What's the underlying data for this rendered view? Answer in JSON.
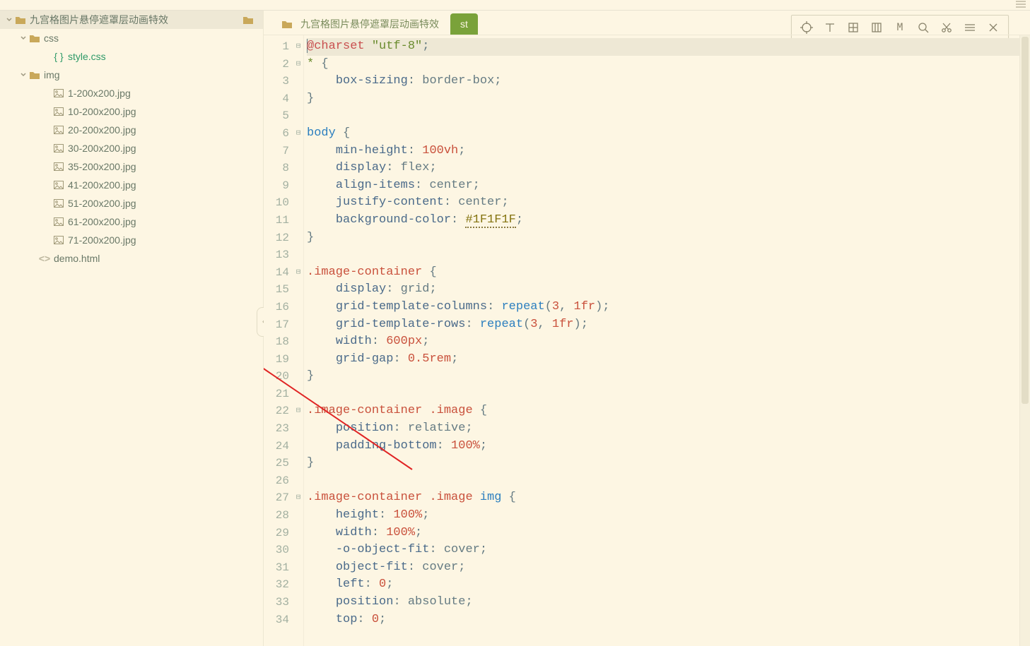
{
  "sidebar": {
    "root": {
      "name": "九宫格图片悬停遮罩层动画特效"
    },
    "css_folder": "css",
    "css_file": "style.css",
    "img_folder": "img",
    "img_files": [
      "1-200x200.jpg",
      "10-200x200.jpg",
      "20-200x200.jpg",
      "30-200x200.jpg",
      "35-200x200.jpg",
      "41-200x200.jpg",
      "51-200x200.jpg",
      "61-200x200.jpg",
      "71-200x200.jpg"
    ],
    "demo_file": "demo.html"
  },
  "tabs": {
    "inactive": "九宫格图片悬停遮罩层动画特效",
    "active_prefix": "st"
  },
  "code": {
    "lines": [
      {
        "n": 1,
        "fold": "⊟",
        "html": "<span class='cursor'></span><span class='tk-at'>@charset</span> <span class='tk-str'>\"utf-8\"</span><span class='tk-punc'>;</span>",
        "active": true
      },
      {
        "n": 2,
        "fold": "⊟",
        "html": "<span class='tk-sel'>*</span> <span class='tk-punc'>{</span>"
      },
      {
        "n": 3,
        "fold": "",
        "html": "    <span class='tk-prop'>box-sizing</span><span class='tk-punc'>:</span> <span class='tk-val'>border-box</span><span class='tk-punc'>;</span>"
      },
      {
        "n": 4,
        "fold": "",
        "html": "<span class='tk-punc'>}</span>"
      },
      {
        "n": 5,
        "fold": "",
        "html": " "
      },
      {
        "n": 6,
        "fold": "⊟",
        "html": "<span class='tk-tag'>body</span> <span class='tk-punc'>{</span>"
      },
      {
        "n": 7,
        "fold": "",
        "html": "    <span class='tk-prop'>min-height</span><span class='tk-punc'>:</span> <span class='tk-num'>100</span><span class='tk-unit'>vh</span><span class='tk-punc'>;</span>"
      },
      {
        "n": 8,
        "fold": "",
        "html": "    <span class='tk-prop'>display</span><span class='tk-punc'>:</span> <span class='tk-val'>flex</span><span class='tk-punc'>;</span>"
      },
      {
        "n": 9,
        "fold": "",
        "html": "    <span class='tk-prop'>align-items</span><span class='tk-punc'>:</span> <span class='tk-val'>center</span><span class='tk-punc'>;</span>"
      },
      {
        "n": 10,
        "fold": "",
        "html": "    <span class='tk-prop'>justify-content</span><span class='tk-punc'>:</span> <span class='tk-val'>center</span><span class='tk-punc'>;</span>"
      },
      {
        "n": 11,
        "fold": "",
        "html": "    <span class='tk-prop'>background-color</span><span class='tk-punc'>:</span> <span class='tk-hex'>#1F1F1F</span><span class='tk-punc'>;</span>"
      },
      {
        "n": 12,
        "fold": "",
        "html": "<span class='tk-punc'>}</span>"
      },
      {
        "n": 13,
        "fold": "",
        "html": " "
      },
      {
        "n": 14,
        "fold": "⊟",
        "html": "<span class='tk-cls'>.image-container</span> <span class='tk-punc'>{</span>"
      },
      {
        "n": 15,
        "fold": "",
        "html": "    <span class='tk-prop'>display</span><span class='tk-punc'>:</span> <span class='tk-val'>grid</span><span class='tk-punc'>;</span>"
      },
      {
        "n": 16,
        "fold": "",
        "html": "    <span class='tk-prop'>grid-template-columns</span><span class='tk-punc'>:</span> <span class='tk-fn'>repeat</span><span class='tk-punc'>(</span><span class='tk-num'>3</span><span class='tk-punc'>,</span> <span class='tk-num'>1</span><span class='tk-unit'>fr</span><span class='tk-punc'>);</span>"
      },
      {
        "n": 17,
        "fold": "",
        "html": "    <span class='tk-prop'>grid-template-rows</span><span class='tk-punc'>:</span> <span class='tk-fn'>repeat</span><span class='tk-punc'>(</span><span class='tk-num'>3</span><span class='tk-punc'>,</span> <span class='tk-num'>1</span><span class='tk-unit'>fr</span><span class='tk-punc'>);</span>"
      },
      {
        "n": 18,
        "fold": "",
        "html": "    <span class='tk-prop'>width</span><span class='tk-punc'>:</span> <span class='tk-num'>600</span><span class='tk-unit'>px</span><span class='tk-punc'>;</span>"
      },
      {
        "n": 19,
        "fold": "",
        "html": "    <span class='tk-prop'>grid-gap</span><span class='tk-punc'>:</span> <span class='tk-num'>0.5</span><span class='tk-unit'>rem</span><span class='tk-punc'>;</span>"
      },
      {
        "n": 20,
        "fold": "",
        "html": "<span class='tk-punc'>}</span>"
      },
      {
        "n": 21,
        "fold": "",
        "html": " "
      },
      {
        "n": 22,
        "fold": "⊟",
        "html": "<span class='tk-cls'>.image-container</span> <span class='tk-cls'>.image</span> <span class='tk-punc'>{</span>"
      },
      {
        "n": 23,
        "fold": "",
        "html": "    <span class='tk-prop'>position</span><span class='tk-punc'>:</span> <span class='tk-val'>relative</span><span class='tk-punc'>;</span>"
      },
      {
        "n": 24,
        "fold": "",
        "html": "    <span class='tk-prop'>padding-bottom</span><span class='tk-punc'>:</span> <span class='tk-num'>100</span><span class='tk-pct'>%</span><span class='tk-punc'>;</span>"
      },
      {
        "n": 25,
        "fold": "",
        "html": "<span class='tk-punc'>}</span>"
      },
      {
        "n": 26,
        "fold": "",
        "html": " "
      },
      {
        "n": 27,
        "fold": "⊟",
        "html": "<span class='tk-cls'>.image-container</span> <span class='tk-cls'>.image</span> <span class='tk-tag'>img</span> <span class='tk-punc'>{</span>"
      },
      {
        "n": 28,
        "fold": "",
        "html": "    <span class='tk-prop'>height</span><span class='tk-punc'>:</span> <span class='tk-num'>100</span><span class='tk-pct'>%</span><span class='tk-punc'>;</span>"
      },
      {
        "n": 29,
        "fold": "",
        "html": "    <span class='tk-prop'>width</span><span class='tk-punc'>:</span> <span class='tk-num'>100</span><span class='tk-pct'>%</span><span class='tk-punc'>;</span>"
      },
      {
        "n": 30,
        "fold": "",
        "html": "    <span class='tk-prop'>-o-object-fit</span><span class='tk-punc'>:</span> <span class='tk-val'>cover</span><span class='tk-punc'>;</span>"
      },
      {
        "n": 31,
        "fold": "",
        "html": "    <span class='tk-prop'>object-fit</span><span class='tk-punc'>:</span> <span class='tk-val'>cover</span><span class='tk-punc'>;</span>"
      },
      {
        "n": 32,
        "fold": "",
        "html": "    <span class='tk-prop'>left</span><span class='tk-punc'>:</span> <span class='tk-num'>0</span><span class='tk-punc'>;</span>"
      },
      {
        "n": 33,
        "fold": "",
        "html": "    <span class='tk-prop'>position</span><span class='tk-punc'>:</span> <span class='tk-val'>absolute</span><span class='tk-punc'>;</span>"
      },
      {
        "n": 34,
        "fold": "",
        "html": "    <span class='tk-prop'>top</span><span class='tk-punc'>:</span> <span class='tk-num'>0</span><span class='tk-punc'>;</span>"
      }
    ]
  },
  "toolbar_icons": [
    "target",
    "text",
    "grid",
    "columns",
    "monospace",
    "search",
    "scissors",
    "list",
    "close"
  ]
}
